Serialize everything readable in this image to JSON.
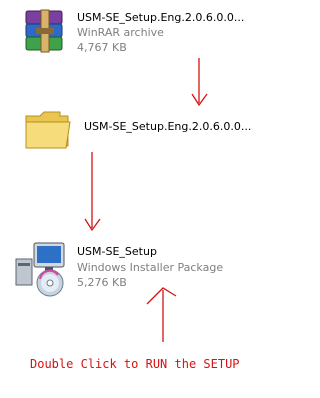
{
  "files": [
    {
      "name": "USM-SE_Setup.Eng.2.0.6.0.0...",
      "type": "WinRAR archive",
      "size": "4,767 KB",
      "icon": "winrar-archive-icon"
    },
    {
      "name": "USM-SE_Setup.Eng.2.0.6.0.0...",
      "icon": "folder-icon"
    },
    {
      "name": "USM-SE_Setup",
      "type": "Windows Installer Package",
      "size": "5,276 KB",
      "icon": "msi-installer-icon"
    }
  ],
  "instruction": "Double Click to RUN the SETUP",
  "colors": {
    "annotation": "#d41414",
    "secondary_text": "#7f7f7f"
  }
}
